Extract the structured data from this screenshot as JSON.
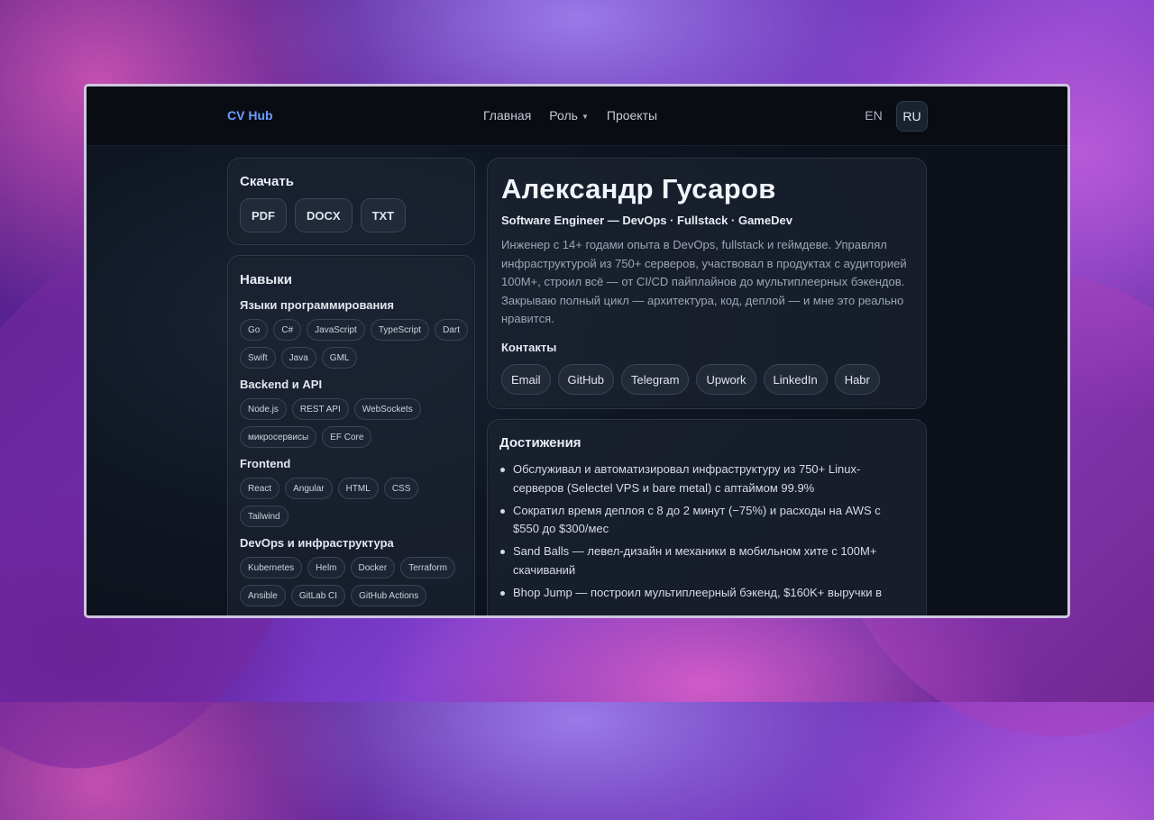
{
  "header": {
    "logo": "CV Hub",
    "nav": {
      "home": "Главная",
      "role": "Роль",
      "projects": "Проекты"
    },
    "languages": [
      "EN",
      "RU"
    ],
    "active_language": "RU"
  },
  "download": {
    "title": "Скачать",
    "buttons": [
      "PDF",
      "DOCX",
      "TXT"
    ]
  },
  "skills": {
    "title": "Навыки",
    "groups": [
      {
        "title": "Языки программирования",
        "items": [
          "Go",
          "C#",
          "JavaScript",
          "TypeScript",
          "Dart",
          "Swift",
          "Java",
          "GML"
        ]
      },
      {
        "title": "Backend и API",
        "items": [
          "Node.js",
          "REST API",
          "WebSockets",
          "микросервисы",
          "EF Core"
        ]
      },
      {
        "title": "Frontend",
        "items": [
          "React",
          "Angular",
          "HTML",
          "CSS",
          "Tailwind"
        ]
      },
      {
        "title": "DevOps и инфраструктура",
        "items": [
          "Kubernetes",
          "Helm",
          "Docker",
          "Terraform",
          "Ansible",
          "GitLab CI",
          "GitHub Actions"
        ]
      }
    ]
  },
  "profile": {
    "name": "Александр Гусаров",
    "subtitle": "Software Engineer — DevOps · Fullstack · GameDev",
    "bio": "Инженер с 14+ годами опыта в DevOps, fullstack и геймдеве. Управлял инфраструктурой из 750+ серверов, участвовал в продуктах с аудиторией 100M+, строил всё — от CI/CD пайплайнов до мультиплеерных бэкендов. Закрываю полный цикл — архитектура, код, деплой — и мне это реально нравится.",
    "contacts_title": "Контакты",
    "contacts": [
      "Email",
      "GitHub",
      "Telegram",
      "Upwork",
      "LinkedIn",
      "Habr"
    ]
  },
  "achievements": {
    "title": "Достижения",
    "items": [
      "Обслуживал и автоматизировал инфраструктуру из 750+ Linux-серверов (Selectel VPS и bare metal) с аптаймом 99.9%",
      "Сократил время деплоя с 8 до 2 минут (−75%) и расходы на AWS с $550 до $300/мес",
      "Sand Balls — левел-дизайн и механики в мобильном хите с 100M+ скачиваний",
      "Bhop Jump — построил мультиплеерный бэкенд, $160K+ выручки в"
    ]
  }
}
